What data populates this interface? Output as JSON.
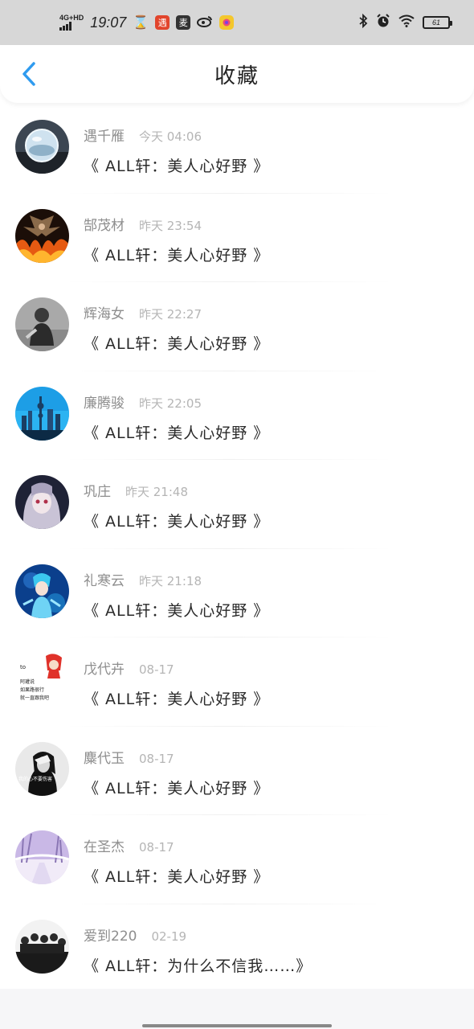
{
  "status_bar": {
    "network": "4G+HD",
    "time": "19:07",
    "battery": "61",
    "app_icons": [
      "hourglass-icon",
      "app-red-icon",
      "app-orange-icon",
      "weibo-icon",
      "app-yellow-icon"
    ],
    "right_icons": [
      "bluetooth-icon",
      "alarm-icon",
      "wifi-icon",
      "battery-icon"
    ]
  },
  "nav": {
    "title": "收藏",
    "back_icon": "chevron-left-icon",
    "accent_color": "#2f9bef"
  },
  "items": [
    {
      "name": "遇千雁",
      "time": "今天 04:06",
      "book": "《 ALL轩：美人心好野 》",
      "avatar": "glass-ball"
    },
    {
      "name": "郜茂材",
      "time": "昨天 23:54",
      "book": "《 ALL轩：美人心好野 》",
      "avatar": "fire-angel"
    },
    {
      "name": "辉海女",
      "time": "昨天 22:27",
      "book": "《 ALL轩：美人心好野 》",
      "avatar": "bw-person"
    },
    {
      "name": "廉腾骏",
      "time": "昨天 22:05",
      "book": "《 ALL轩：美人心好野 》",
      "avatar": "city-skyline"
    },
    {
      "name": "巩庄",
      "time": "昨天 21:48",
      "book": "《 ALL轩：美人心好野 》",
      "avatar": "anime-girl"
    },
    {
      "name": "礼寒云",
      "time": "昨天 21:18",
      "book": "《 ALL轩：美人心好野 》",
      "avatar": "anime-blue"
    },
    {
      "name": "戊代卉",
      "time": "08-17",
      "book": "《 ALL轩：美人心好野 》",
      "avatar": "red-hood",
      "avatar_text": [
        "to",
        "阿瓘说",
        "如果路很行",
        "就一直跟我吧"
      ]
    },
    {
      "name": "麋代玉",
      "time": "08-17",
      "book": "《 ALL轩：美人心好野 》",
      "avatar": "bw-woman",
      "avatar_text": [
        "我的心不要伤害"
      ]
    },
    {
      "name": "在圣杰",
      "time": "08-17",
      "book": "《 ALL轩：美人心好野 》",
      "avatar": "purple-winter"
    },
    {
      "name": "爱到220",
      "time": "02-19",
      "book": "《 ALL轩：为什么不信我……》",
      "avatar": "group-photo"
    }
  ]
}
